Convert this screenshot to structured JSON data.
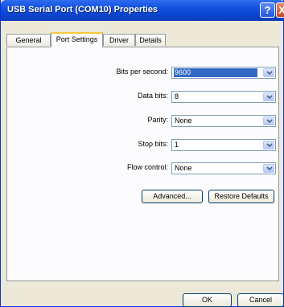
{
  "window": {
    "title": "USB Serial Port (COM10) Properties"
  },
  "titlebar": {
    "help_label": "?",
    "close_label": "X"
  },
  "tabs": [
    {
      "label": "General"
    },
    {
      "label": "Port Settings"
    },
    {
      "label": "Driver"
    },
    {
      "label": "Details"
    }
  ],
  "settings": {
    "bits_per_second": {
      "label": "Bits per second:",
      "value": "9600"
    },
    "data_bits": {
      "label": "Data bits:",
      "value": "8"
    },
    "parity": {
      "label": "Parity:",
      "value": "None"
    },
    "stop_bits": {
      "label": "Stop bits:",
      "value": "1"
    },
    "flow_control": {
      "label": "Flow control:",
      "value": "None"
    }
  },
  "buttons": {
    "advanced": "Advanced...",
    "restore_defaults": "Restore Defaults",
    "ok": "OK",
    "cancel": "Cancel"
  },
  "icons": {
    "dropdown": "chevron-down-icon",
    "help": "help-icon",
    "close": "close-icon"
  },
  "colors": {
    "title_bar": "#0a45d0",
    "selection": "#316ac5",
    "dialog_face": "#ece9d8",
    "active_tab_accent": "#ffc83c"
  }
}
